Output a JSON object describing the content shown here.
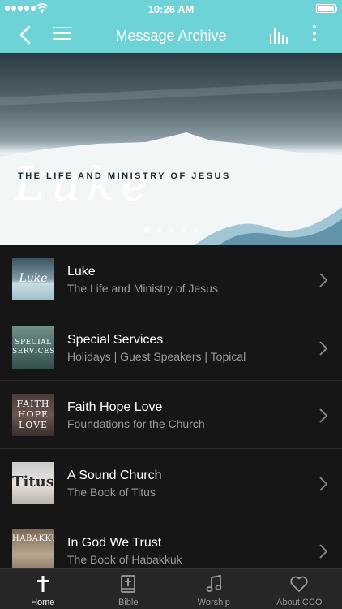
{
  "status_bar": {
    "time": "10:26 AM"
  },
  "nav": {
    "title": "Message Archive",
    "back_icon": "chevron-left-icon",
    "menu_icon": "hamburger-icon",
    "audio_icon": "audio-bars-icon",
    "more_icon": "more-vertical-icon"
  },
  "hero": {
    "script_title": "Luke",
    "subtitle": "THE LIFE AND MINISTRY OF JESUS",
    "slide_count": 5,
    "active_slide": 1
  },
  "series": [
    {
      "title": "Luke",
      "subtitle": "The Life and Ministry of Jesus",
      "thumb_text": ""
    },
    {
      "title": "Special Services",
      "subtitle": "Holidays | Guest Speakers | Topical",
      "thumb_text": "SPECIAL SERVICES"
    },
    {
      "title": "Faith Hope Love",
      "subtitle": "Foundations for the Church",
      "thumb_text": "FAITH HOPE LOVE"
    },
    {
      "title": "A Sound Church",
      "subtitle": "The Book of Titus",
      "thumb_text": "Titus"
    },
    {
      "title": "In God We Trust",
      "subtitle": "The Book of Habakkuk",
      "thumb_text": "HABAKKUK"
    }
  ],
  "tabs": [
    {
      "label": "Home",
      "icon": "cross-icon",
      "active": true
    },
    {
      "label": "Bible",
      "icon": "bible-icon",
      "active": false
    },
    {
      "label": "Worship",
      "icon": "music-note-icon",
      "active": false
    },
    {
      "label": "About CCO",
      "icon": "heart-icon",
      "active": false
    }
  ],
  "colors": {
    "accent": "#6dd3d6",
    "list_bg": "#161616",
    "tab_bg": "#262626"
  }
}
